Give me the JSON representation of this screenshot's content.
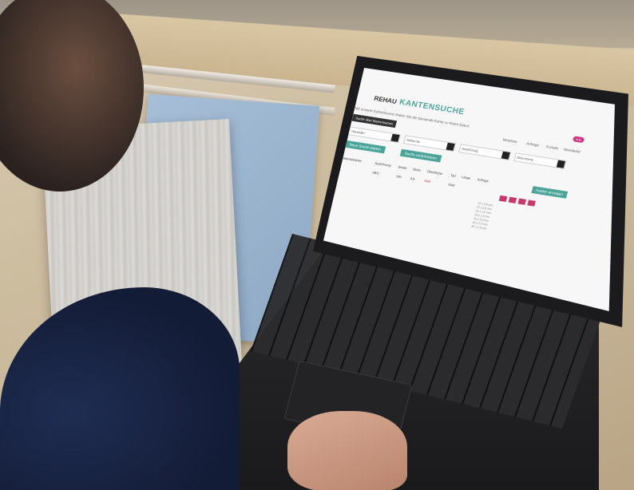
{
  "website": {
    "logo": "REHAU",
    "title": "KANTENSUCHE",
    "intro": "Mit unserer Kantensuche finden Sie die passende Kante zu Ihrem Dekor.",
    "search_button": "Suche über Markennamen",
    "nav": [
      "Merkliste",
      "Anfrage",
      "Kontakt",
      "Newsletter"
    ],
    "filters": [
      "Hersteller",
      "Artikel-Nr.",
      "Ausführung",
      "Dekorname"
    ],
    "buttons": {
      "primary": "Neue Suche starten",
      "secondary": "Suche zurücksetzen",
      "results": "Kanten anzeigen",
      "pink": "● ●"
    },
    "columns": [
      "Materialstärke",
      "Ausführung",
      "Breite",
      "Dicke",
      "Oberfläche",
      "Typ",
      "Länge",
      "Anfrage"
    ],
    "row": [
      "ABS",
      "190",
      "0,8",
      "Matt",
      "Glatt"
    ],
    "sizes": [
      "19 x 0,8 mm",
      "22 x 0,8 mm",
      "23 x 1,0 mm",
      "28 x 1,0 mm",
      "33 x 2,0 mm",
      "43 x 2,0 mm",
      "55 x 2,0 mm"
    ]
  },
  "colors": {
    "accent": "#4aa49a",
    "highlight": "#d13a83",
    "laptop": "#1b1b1d"
  }
}
